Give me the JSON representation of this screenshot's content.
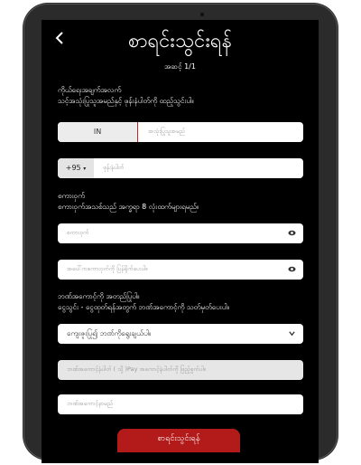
{
  "header": {
    "back_icon": "chevron-left-icon",
    "title": "စာရင်းသွင်းရန်",
    "step": "အဆင့် 1/1"
  },
  "identity": {
    "heading_line1": "ကိုယ်ရေးအချက်အလက်",
    "heading_line2": "သင့်အသုံးပြုသူအမည်နှင့် ဖုန်းနံပါတ်ကို ထည့်သွင်းပါ။",
    "country": "IN",
    "username_placeholder": "အသုံးပြုသူအမည်",
    "phone_code": "+95",
    "phone_placeholder": "ဖုန်းနံပါတ်"
  },
  "password": {
    "heading_line1": "စကားဝှက်",
    "heading_line2": "စကားဝှက်အသစ်သည် အက္ခရာ 8 လုံးထက်များရမည်။",
    "password_placeholder": "စကားဝှက်",
    "confirm_placeholder": "အပေါ်ကစကားဝှက်ကို ပြန်ရိုက်ပေးပါ။"
  },
  "bank": {
    "heading_line1": "ဘဏ်အကောင့်ကို အတည်ပြုပါ။",
    "heading_line2": "ငွေသွင်း - ငွေထုတ်ရန်အတွက် ဘဏ်အကောင့်ကို သတ်မှတ်ပေးပါ။",
    "select_value": "ကျေးဇူးပြု၍ ဘဏ်ကိုရွေးချယ်ပါ။",
    "account_placeholder": "ဘဏ်အကောင့်နံပါတ် ( သို့ )Pay အကောင့်နံပါတ်ကို ဖြည့်စွက်ပါ။",
    "name_placeholder": "ဘဏ်အကောင့်နာမည်"
  },
  "submit_label": "စာရင်းသွင်းရန်",
  "colors": {
    "accent": "#b31b1b",
    "background": "#000000",
    "field": "#ffffff"
  }
}
